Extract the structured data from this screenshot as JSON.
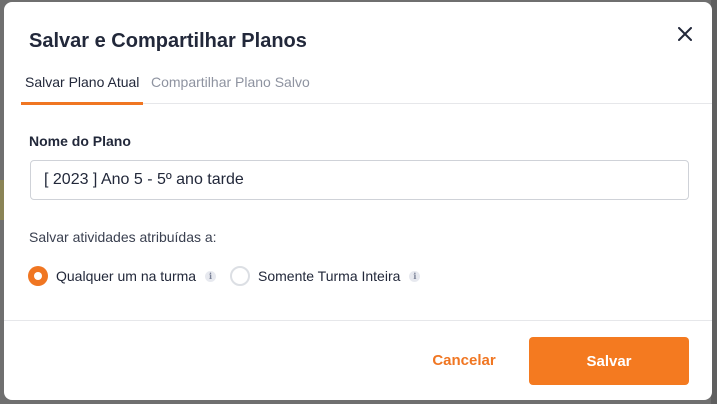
{
  "dialog": {
    "title": "Salvar e Compartilhar Planos",
    "close_icon": "close-icon"
  },
  "tabs": [
    {
      "label": "Salvar Plano Atual",
      "active": true
    },
    {
      "label": "Compartilhar Plano Salvo",
      "active": false
    }
  ],
  "form": {
    "plan_name_label": "Nome do Plano",
    "plan_name_value": "[ 2023 ] Ano 5 - 5º ano tarde",
    "assign_label": "Salvar atividades atribuídas a:",
    "options": [
      {
        "label": "Qualquer um na turma",
        "selected": true,
        "info_icon": "info-icon"
      },
      {
        "label": "Somente Turma Inteira",
        "selected": false,
        "info_icon": "info-icon"
      }
    ]
  },
  "footer": {
    "cancel_label": "Cancelar",
    "save_label": "Salvar"
  },
  "colors": {
    "accent": "#f07622",
    "title": "#22283a",
    "muted_tab": "#8e93a0"
  }
}
